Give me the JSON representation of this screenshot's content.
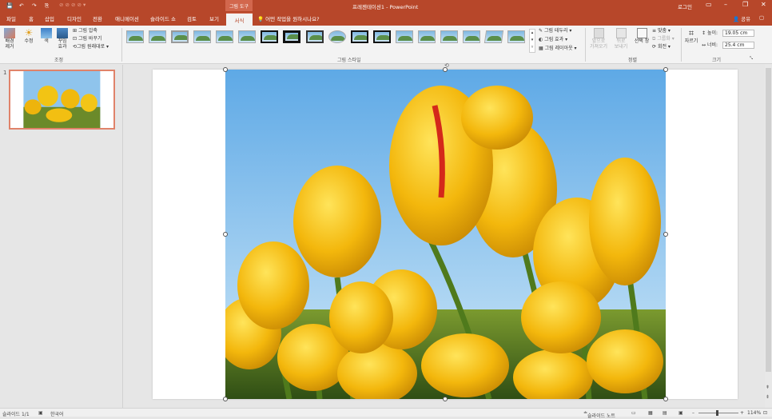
{
  "titlebar": {
    "title": "프레젠테이션1 - PowerPoint",
    "context_tab": "그림 도구",
    "login": "로그인",
    "quick_access": [
      "💾",
      "↶",
      "↷",
      "⎘"
    ]
  },
  "tabs": [
    "파일",
    "홈",
    "삽입",
    "디자인",
    "전환",
    "애니메이션",
    "슬라이드 쇼",
    "검토",
    "보기"
  ],
  "active_tab": "서식",
  "tell_me": "어떤 작업을 원하시나요?",
  "share": "공유",
  "ribbon": {
    "adjust": {
      "remove_bg": "배경\n제거",
      "corrections": "수정",
      "color": "색",
      "artistic": "꾸밈\n효과",
      "compress": "그림 압축",
      "change": "그림 바꾸기",
      "reset": "그림 원래대로",
      "group_label": "조정"
    },
    "styles": {
      "border": "그림 테두리",
      "effects": "그림 효과",
      "layout": "그림 레이아웃",
      "group_label": "그림 스타일"
    },
    "arrange": {
      "bring_forward": "앞으로\n가져오기",
      "send_backward": "뒤로\n보내기",
      "selection_pane": "선택 창",
      "align": "맞춤",
      "group": "그룹화",
      "rotate": "회전",
      "group_label": "정렬"
    },
    "size": {
      "crop": "자르기",
      "height_label": "높이:",
      "height_value": "19.05 cm",
      "width_label": "너비:",
      "width_value": "25.4 cm",
      "group_label": "크기"
    }
  },
  "slides_pane": {
    "slide_number": "1"
  },
  "status": {
    "slide_info": "슬라이드 1/1",
    "language": "한국어",
    "notes": "슬라이드 노트",
    "zoom": "114%"
  }
}
